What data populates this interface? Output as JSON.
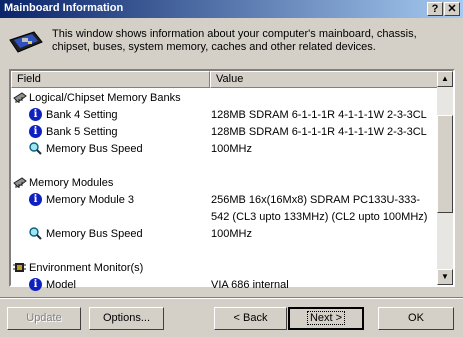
{
  "window": {
    "title": "Mainboard Information",
    "help_label": "?",
    "close_label": "✕"
  },
  "header": {
    "description": "This window shows information about your computer's mainboard, chassis, chipset, buses, system memory, caches and other related devices."
  },
  "list": {
    "columns": [
      "Field",
      "Value"
    ],
    "rows": [
      {
        "type": "group",
        "icon": "memory-chip-icon",
        "field": "Logical/Chipset Memory Banks",
        "value": ""
      },
      {
        "type": "item",
        "icon": "info-icon",
        "field": "Bank 4 Setting",
        "value": "128MB SDRAM 6-1-1-1R 4-1-1-1W 2-3-3CL"
      },
      {
        "type": "item",
        "icon": "info-icon",
        "field": "Bank 5 Setting",
        "value": "128MB SDRAM 6-1-1-1R 4-1-1-1W 2-3-3CL"
      },
      {
        "type": "item",
        "icon": "magnifier-icon",
        "field": "Memory Bus Speed",
        "value": "100MHz"
      },
      {
        "type": "group",
        "icon": "memory-chip-icon",
        "field": "Memory Modules",
        "value": ""
      },
      {
        "type": "item",
        "icon": "info-icon",
        "field": "Memory Module 3",
        "value": "256MB 16x(16Mx8) SDRAM PC133U-333-",
        "value2": "542 (CL3 upto 133MHz) (CL2 upto 100MHz)"
      },
      {
        "type": "item",
        "icon": "magnifier-icon",
        "field": "Memory Bus Speed",
        "value": "100MHz"
      },
      {
        "type": "group",
        "icon": "chip-icon",
        "field": "Environment Monitor(s)",
        "value": ""
      },
      {
        "type": "item",
        "icon": "info-icon",
        "field": "Model",
        "value": "VIA 686 internal"
      }
    ]
  },
  "buttons": {
    "update": "Update",
    "options": "Options...",
    "back": "< Back",
    "next": "Next >",
    "ok": "OK"
  }
}
